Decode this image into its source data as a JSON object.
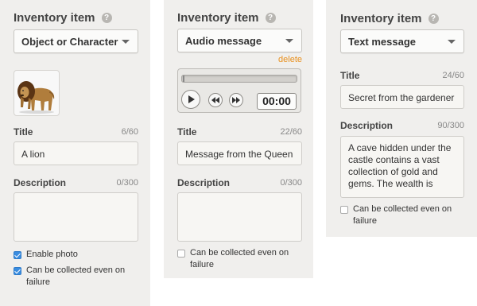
{
  "panels": [
    {
      "header": "Inventory item",
      "help_icon": "?",
      "dropdown": "Object or Character",
      "title_label": "Title",
      "title_count": "6/60",
      "title_value": "A lion",
      "description_label": "Description",
      "description_count": "0/300",
      "description_value": "",
      "checkboxes": [
        {
          "label": "Enable photo",
          "checked": true
        },
        {
          "label": "Can be collected even on failure",
          "checked": true
        }
      ]
    },
    {
      "header": "Inventory item",
      "help_icon": "?",
      "dropdown": "Audio message",
      "delete_link": "delete",
      "player_time": "00:00",
      "title_label": "Title",
      "title_count": "22/60",
      "title_value": "Message from the Queen",
      "description_label": "Description",
      "description_count": "0/300",
      "description_value": "",
      "checkboxes": [
        {
          "label": "Can be collected even on failure",
          "checked": false
        }
      ]
    },
    {
      "header": "Inventory item",
      "help_icon": "?",
      "dropdown": "Text message",
      "title_label": "Title",
      "title_count": "24/60",
      "title_value": "Secret from the gardener",
      "description_label": "Description",
      "description_count": "90/300",
      "description_value": "A cave hidden under the castle contains a vast collection of gold and gems. The wealth is",
      "checkboxes": [
        {
          "label": "Can be collected even on failure",
          "checked": false
        }
      ]
    }
  ],
  "icons": {
    "help": "help-icon",
    "dropdown": "chevron-down-icon",
    "play": "play-icon",
    "rewind": "rewind-icon",
    "forward": "fast-forward-icon",
    "check": "check-icon"
  },
  "colors": {
    "panel_bg": "#f0efed",
    "accent_blue": "#3b8de0",
    "delete_orange": "#e8901e"
  }
}
